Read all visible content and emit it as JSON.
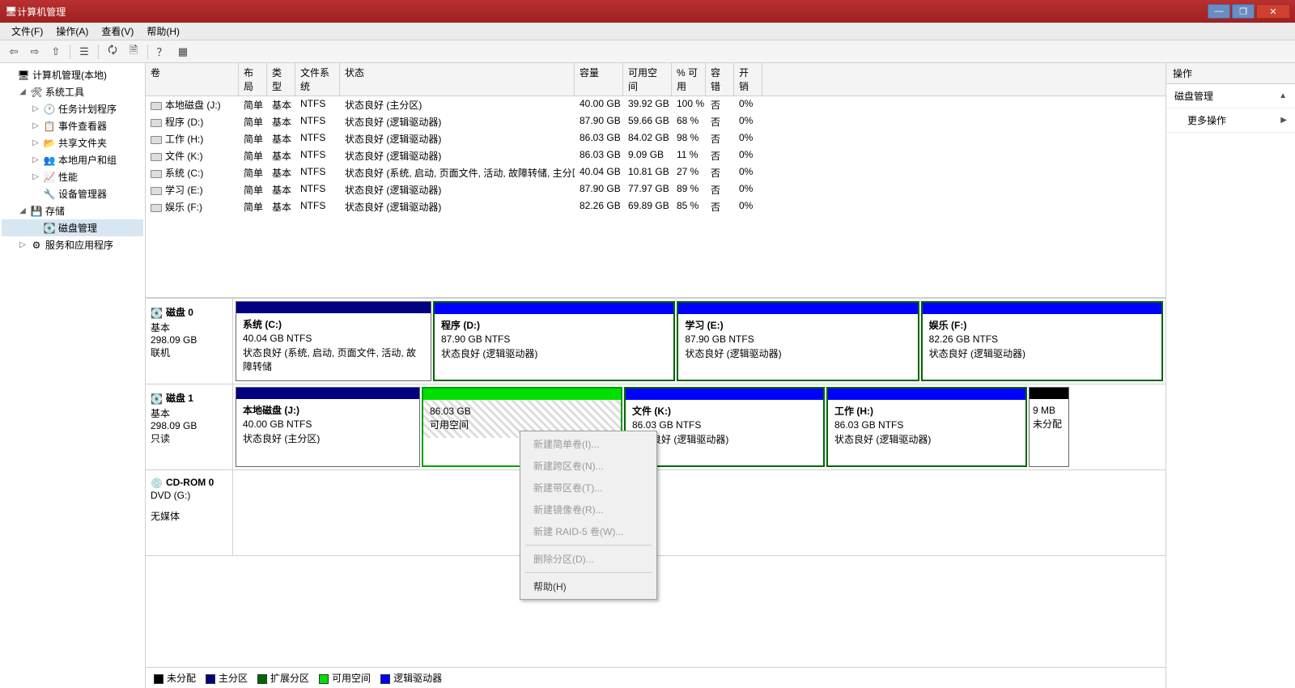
{
  "window": {
    "title": "计算机管理"
  },
  "win_buttons": {
    "min": "—",
    "max": "❐",
    "close": "✕"
  },
  "menubar": {
    "file": "文件(F)",
    "action": "操作(A)",
    "view": "查看(V)",
    "help": "帮助(H)"
  },
  "toolbar": {
    "back": "⇦",
    "fwd": "⇨",
    "up": "⇧",
    "props": "☰",
    "refresh": "🗘",
    "export": "🗎",
    "help": "？",
    "extra": "▦"
  },
  "tree": {
    "root": "计算机管理(本地)",
    "sys_tools": "系统工具",
    "task_sched": "任务计划程序",
    "event_viewer": "事件查看器",
    "shared": "共享文件夹",
    "users": "本地用户和组",
    "perf": "性能",
    "devmgr": "设备管理器",
    "storage": "存储",
    "diskmgmt": "磁盘管理",
    "services": "服务和应用程序"
  },
  "columns": {
    "vol": "卷",
    "layout": "布局",
    "type": "类型",
    "fs": "文件系统",
    "status": "状态",
    "capacity": "容量",
    "free": "可用空间",
    "pct": "% 可用",
    "fault": "容错",
    "overhead": "开销"
  },
  "volumes": [
    {
      "name": "本地磁盘 (J:)",
      "layout": "简单",
      "type": "基本",
      "fs": "NTFS",
      "status": "状态良好 (主分区)",
      "cap": "40.00 GB",
      "free": "39.92 GB",
      "pct": "100 %",
      "fault": "否",
      "oh": "0%"
    },
    {
      "name": "程序 (D:)",
      "layout": "简单",
      "type": "基本",
      "fs": "NTFS",
      "status": "状态良好 (逻辑驱动器)",
      "cap": "87.90 GB",
      "free": "59.66 GB",
      "pct": "68 %",
      "fault": "否",
      "oh": "0%"
    },
    {
      "name": "工作 (H:)",
      "layout": "简单",
      "type": "基本",
      "fs": "NTFS",
      "status": "状态良好 (逻辑驱动器)",
      "cap": "86.03 GB",
      "free": "84.02 GB",
      "pct": "98 %",
      "fault": "否",
      "oh": "0%"
    },
    {
      "name": "文件 (K:)",
      "layout": "简单",
      "type": "基本",
      "fs": "NTFS",
      "status": "状态良好 (逻辑驱动器)",
      "cap": "86.03 GB",
      "free": "9.09 GB",
      "pct": "11 %",
      "fault": "否",
      "oh": "0%"
    },
    {
      "name": "系统 (C:)",
      "layout": "简单",
      "type": "基本",
      "fs": "NTFS",
      "status": "状态良好 (系统, 启动, 页面文件, 活动, 故障转储, 主分区)",
      "cap": "40.04 GB",
      "free": "10.81 GB",
      "pct": "27 %",
      "fault": "否",
      "oh": "0%"
    },
    {
      "name": "学习 (E:)",
      "layout": "简单",
      "type": "基本",
      "fs": "NTFS",
      "status": "状态良好 (逻辑驱动器)",
      "cap": "87.90 GB",
      "free": "77.97 GB",
      "pct": "89 %",
      "fault": "否",
      "oh": "0%"
    },
    {
      "name": "娱乐 (F:)",
      "layout": "简单",
      "type": "基本",
      "fs": "NTFS",
      "status": "状态良好 (逻辑驱动器)",
      "cap": "82.26 GB",
      "free": "69.89 GB",
      "pct": "85 %",
      "fault": "否",
      "oh": "0%"
    }
  ],
  "disks": {
    "d0": {
      "title": "磁盘 0",
      "type": "基本",
      "size": "298.09 GB",
      "state": "联机"
    },
    "d1": {
      "title": "磁盘 1",
      "type": "基本",
      "size": "298.09 GB",
      "state": "只读"
    },
    "cd": {
      "title": "CD-ROM 0",
      "type": "DVD (G:)",
      "state": "无媒体"
    }
  },
  "d0parts": [
    {
      "name": "系统   (C:)",
      "line2": "40.04 GB NTFS",
      "line3": "状态良好 (系统, 启动, 页面文件, 活动, 故障转储"
    },
    {
      "name": "程序   (D:)",
      "line2": "87.90 GB NTFS",
      "line3": "状态良好 (逻辑驱动器)"
    },
    {
      "name": "学习   (E:)",
      "line2": "87.90 GB NTFS",
      "line3": "状态良好 (逻辑驱动器)"
    },
    {
      "name": "娱乐   (F:)",
      "line2": "82.26 GB NTFS",
      "line3": "状态良好 (逻辑驱动器)"
    }
  ],
  "d1parts": [
    {
      "name": "本地磁盘   (J:)",
      "line2": "40.00 GB NTFS",
      "line3": "状态良好 (主分区)"
    },
    {
      "name": "",
      "line2": "86.03 GB",
      "line3": "可用空间"
    },
    {
      "name": "文件   (K:)",
      "line2": "86.03 GB NTFS",
      "line3": "状态良好 (逻辑驱动器)"
    },
    {
      "name": "工作   (H:)",
      "line2": "86.03 GB NTFS",
      "line3": "状态良好 (逻辑驱动器)"
    },
    {
      "name": "",
      "line2": "9 MB",
      "line3": "未分配"
    }
  ],
  "legend": {
    "unalloc": "未分配",
    "primary": "主分区",
    "extended": "扩展分区",
    "freespace": "可用空间",
    "logical": "逻辑驱动器"
  },
  "actions": {
    "title": "操作",
    "section": "磁盘管理",
    "more": "更多操作"
  },
  "context": {
    "new_simple": "新建简单卷(I)...",
    "new_span": "新建跨区卷(N)...",
    "new_stripe": "新建带区卷(T)...",
    "new_mirror": "新建镜像卷(R)...",
    "new_raid5": "新建 RAID-5 卷(W)...",
    "delete": "删除分区(D)...",
    "help": "帮助(H)"
  }
}
